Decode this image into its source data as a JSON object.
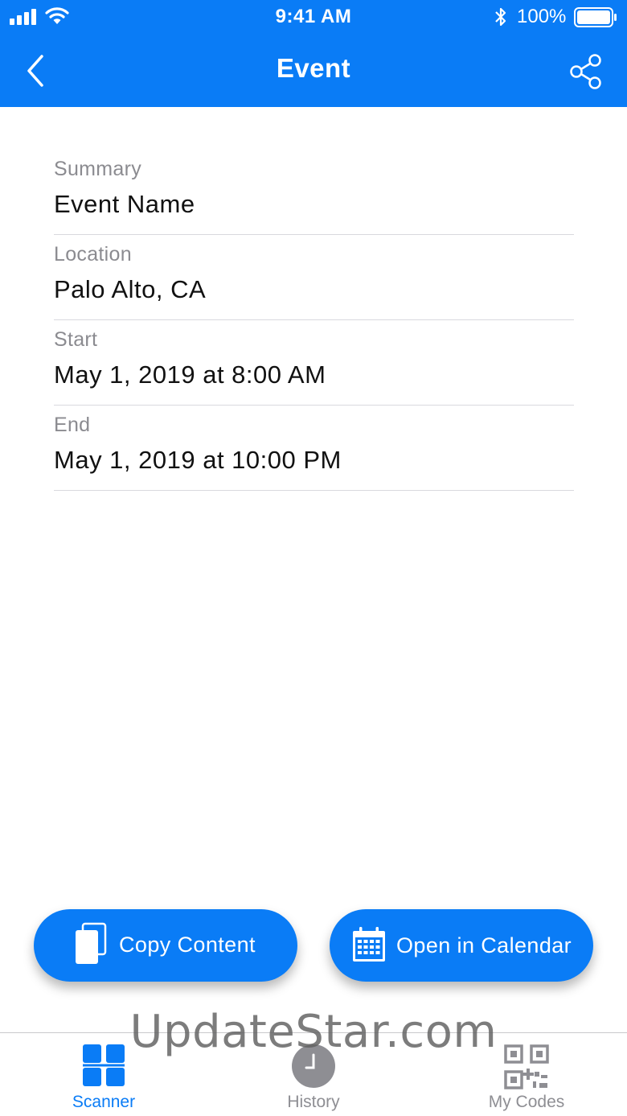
{
  "status_bar": {
    "time": "9:41 AM",
    "battery_percent": "100%",
    "icons": [
      "signal-icon",
      "wifi-icon",
      "bluetooth-icon",
      "battery-icon"
    ]
  },
  "nav": {
    "title": "Event",
    "back_icon": "chevron-left-icon",
    "share_icon": "share-icon"
  },
  "fields": [
    {
      "label": "Summary",
      "value": "Event Name"
    },
    {
      "label": "Location",
      "value": "Palo Alto, CA"
    },
    {
      "label": "Start",
      "value": "May 1, 2019 at 8:00 AM"
    },
    {
      "label": "End",
      "value": "May 1, 2019 at 10:00 PM"
    }
  ],
  "actions": {
    "copy_label": "Copy Content",
    "copy_icon": "copy-icon",
    "calendar_label": "Open in Calendar",
    "calendar_icon": "calendar-icon"
  },
  "watermark": "UpdateStar.com",
  "tabs": [
    {
      "label": "Scanner",
      "icon": "grid-icon",
      "active": true
    },
    {
      "label": "History",
      "icon": "clock-icon",
      "active": false
    },
    {
      "label": "My Codes",
      "icon": "qr-code-icon",
      "active": false
    }
  ],
  "colors": {
    "accent": "#0a7cf6",
    "inactive_tab": "#8e8e93",
    "label_gray": "#8b8b90",
    "divider": "#d9d9de"
  }
}
